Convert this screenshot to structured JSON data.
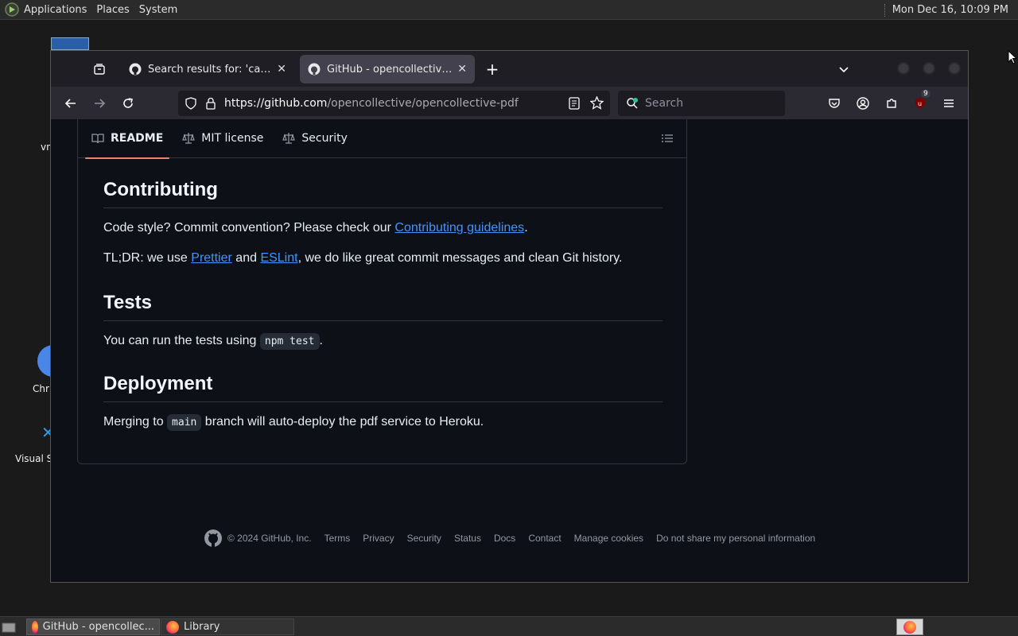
{
  "top_panel": {
    "menus": [
      "Applications",
      "Places",
      "System"
    ],
    "clock": "Mon Dec 16, 10:09 PM"
  },
  "desktop": {
    "icons": [
      {
        "label": "vn"
      },
      {
        "label": "Chr"
      },
      {
        "label": "Visual S"
      }
    ]
  },
  "browser": {
    "tabs": [
      {
        "title": "Search results for: 'card'",
        "active": false
      },
      {
        "title": "GitHub - opencollective/opencollective-pdf",
        "active": true
      }
    ],
    "new_tab_label": "+",
    "url_host": "https://github.com",
    "url_path": "/opencollective/opencollective-pdf",
    "search_placeholder": "Search",
    "extension_badge": "9"
  },
  "readme_tabs": [
    {
      "label": "README",
      "icon": "book-icon",
      "active": true
    },
    {
      "label": "MIT license",
      "icon": "scale-icon",
      "active": false
    },
    {
      "label": "Security",
      "icon": "scale-icon",
      "active": false
    }
  ],
  "content": {
    "contributing": {
      "heading": "Contributing",
      "p1_pre": "Code style? Commit convention? Please check our ",
      "p1_link": "Contributing guidelines",
      "p1_post": ".",
      "p2_pre": "TL;DR: we use ",
      "p2_link1": "Prettier",
      "p2_mid": " and ",
      "p2_link2": "ESLint",
      "p2_post": ", we do like great commit messages and clean Git history."
    },
    "tests": {
      "heading": "Tests",
      "pre": "You can run the tests using ",
      "code": "npm test",
      "post": "."
    },
    "deployment": {
      "heading": "Deployment",
      "pre": "Merging to ",
      "code": "main",
      "post": " branch will auto-deploy the pdf service to Heroku."
    }
  },
  "footer": {
    "copyright": "© 2024 GitHub, Inc.",
    "links": [
      "Terms",
      "Privacy",
      "Security",
      "Status",
      "Docs",
      "Contact",
      "Manage cookies",
      "Do not share my personal information"
    ]
  },
  "taskbar": {
    "items": [
      {
        "label": "GitHub - opencollec..."
      },
      {
        "label": "Library"
      }
    ]
  },
  "colors": {
    "link": "#4493f8",
    "active_tab_underline": "#f78166",
    "page_bg": "#0d1117"
  }
}
